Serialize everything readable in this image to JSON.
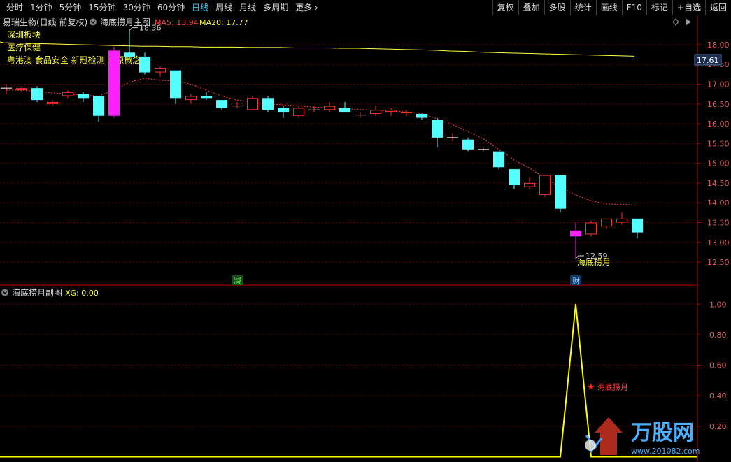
{
  "toolbar": {
    "periods": [
      "分时",
      "1分钟",
      "5分钟",
      "15分钟",
      "30分钟",
      "60分钟",
      "日线",
      "周线",
      "月线",
      "多周期",
      "更多"
    ],
    "active_period": "日线",
    "right_buttons": [
      "复权",
      "叠加",
      "多股",
      "统计",
      "画线",
      "F10",
      "标记",
      "+自选",
      "返回"
    ]
  },
  "main_header": {
    "title": "易瑞生物(日线 前复权)",
    "indicator_name": "海底捞月主图",
    "ma5_label": "MA5: 13.94",
    "ma20_label": "MA20: 17.77",
    "ma5_color": "#ff4040",
    "ma20_color": "#ffff40"
  },
  "info_overlay": {
    "line1": "深圳板块",
    "line2": "医疗保健",
    "line3": "粤港澳 食品安全 新冠检测 抗原概念"
  },
  "sub_header": {
    "name": "海底捞月副图",
    "xg_label": "XG: 0.00"
  },
  "annotations": {
    "high_label": "18.36",
    "low_label": "12.59",
    "signal_label": "海底捞月",
    "sub_signal_label": "海底捞月",
    "marker_jian": "减",
    "marker_cai": "财",
    "current_price": "17.61"
  },
  "watermark": {
    "brand": "万股网",
    "url": "www.201082.com"
  },
  "colors": {
    "up": "#ff3030",
    "down": "#54ffff",
    "signal": "#ff20ff",
    "grid": "#6a0000",
    "axis": "#c00000",
    "xg_line": "#ffff00"
  },
  "chart_data": [
    {
      "type": "candlestick",
      "title": "易瑞生物(日线 前复权)",
      "y_axis_ticks": [
        12.5,
        13.0,
        13.5,
        14.0,
        14.5,
        15.0,
        15.5,
        16.0,
        16.5,
        17.0,
        17.5,
        18.0
      ],
      "ylim": [
        12.2,
        18.6
      ],
      "candles": [
        {
          "o": 16.9,
          "h": 17.0,
          "l": 16.75,
          "c": 16.9
        },
        {
          "o": 16.85,
          "h": 16.95,
          "l": 16.8,
          "c": 16.9
        },
        {
          "o": 16.9,
          "h": 16.95,
          "l": 16.55,
          "c": 16.6
        },
        {
          "o": 16.5,
          "h": 16.6,
          "l": 16.45,
          "c": 16.55
        },
        {
          "o": 16.7,
          "h": 16.85,
          "l": 16.65,
          "c": 16.8
        },
        {
          "o": 16.75,
          "h": 16.8,
          "l": 16.55,
          "c": 16.65
        },
        {
          "o": 16.7,
          "h": 16.7,
          "l": 16.05,
          "c": 16.2
        },
        {
          "o": 16.2,
          "h": 17.95,
          "l": 16.15,
          "c": 17.85,
          "signal": true
        },
        {
          "o": 17.8,
          "h": 18.36,
          "l": 17.7,
          "c": 17.7
        },
        {
          "o": 17.7,
          "h": 17.8,
          "l": 17.25,
          "c": 17.3
        },
        {
          "o": 17.3,
          "h": 17.45,
          "l": 17.2,
          "c": 17.4
        },
        {
          "o": 17.35,
          "h": 17.35,
          "l": 16.5,
          "c": 16.65
        },
        {
          "o": 16.6,
          "h": 16.75,
          "l": 16.5,
          "c": 16.7
        },
        {
          "o": 16.7,
          "h": 16.8,
          "l": 16.6,
          "c": 16.65
        },
        {
          "o": 16.6,
          "h": 16.6,
          "l": 16.35,
          "c": 16.4
        },
        {
          "o": 16.45,
          "h": 16.55,
          "l": 16.4,
          "c": 16.45
        },
        {
          "o": 16.35,
          "h": 16.7,
          "l": 16.35,
          "c": 16.65
        },
        {
          "o": 16.65,
          "h": 16.7,
          "l": 16.3,
          "c": 16.35
        },
        {
          "o": 16.4,
          "h": 16.45,
          "l": 16.15,
          "c": 16.3
        },
        {
          "o": 16.2,
          "h": 16.45,
          "l": 16.15,
          "c": 16.4
        },
        {
          "o": 16.35,
          "h": 16.45,
          "l": 16.3,
          "c": 16.35
        },
        {
          "o": 16.35,
          "h": 16.55,
          "l": 16.3,
          "c": 16.45
        },
        {
          "o": 16.4,
          "h": 16.55,
          "l": 16.3,
          "c": 16.3
        },
        {
          "o": 16.22,
          "h": 16.3,
          "l": 16.15,
          "c": 16.22
        },
        {
          "o": 16.25,
          "h": 16.45,
          "l": 16.2,
          "c": 16.35
        },
        {
          "o": 16.3,
          "h": 16.4,
          "l": 16.2,
          "c": 16.35
        },
        {
          "o": 16.28,
          "h": 16.35,
          "l": 16.2,
          "c": 16.3
        },
        {
          "o": 16.25,
          "h": 16.25,
          "l": 16.1,
          "c": 16.15
        },
        {
          "o": 16.1,
          "h": 16.15,
          "l": 15.4,
          "c": 15.65
        },
        {
          "o": 15.65,
          "h": 15.75,
          "l": 15.55,
          "c": 15.65
        },
        {
          "o": 15.6,
          "h": 15.65,
          "l": 15.3,
          "c": 15.35
        },
        {
          "o": 15.35,
          "h": 15.4,
          "l": 15.3,
          "c": 15.35
        },
        {
          "o": 15.3,
          "h": 15.3,
          "l": 14.85,
          "c": 14.9
        },
        {
          "o": 14.85,
          "h": 14.85,
          "l": 14.35,
          "c": 14.45
        },
        {
          "o": 14.4,
          "h": 14.65,
          "l": 14.35,
          "c": 14.5
        },
        {
          "o": 14.2,
          "h": 14.7,
          "l": 14.15,
          "c": 14.7
        },
        {
          "o": 14.7,
          "h": 14.7,
          "l": 13.75,
          "c": 13.85
        },
        {
          "o": 13.15,
          "h": 13.5,
          "l": 12.59,
          "c": 13.3,
          "signal": true
        },
        {
          "o": 13.2,
          "h": 13.55,
          "l": 13.15,
          "c": 13.5
        },
        {
          "o": 13.4,
          "h": 13.6,
          "l": 13.35,
          "c": 13.6
        },
        {
          "o": 13.5,
          "h": 13.75,
          "l": 13.45,
          "c": 13.6
        },
        {
          "o": 13.6,
          "h": 13.6,
          "l": 13.1,
          "c": 13.25
        }
      ],
      "ma5": [
        16.85,
        16.85,
        16.82,
        16.78,
        16.75,
        16.72,
        16.7,
        16.85,
        17.05,
        17.15,
        17.1,
        17.08,
        17.0,
        16.85,
        16.7,
        16.6,
        16.55,
        16.5,
        16.48,
        16.45,
        16.42,
        16.4,
        16.38,
        16.36,
        16.34,
        16.32,
        16.3,
        16.26,
        16.12,
        15.98,
        15.8,
        15.62,
        15.35,
        15.08,
        14.88,
        14.62,
        14.4,
        14.2,
        14.05,
        13.97,
        13.96,
        13.94
      ],
      "ma20": [
        18.05,
        18.04,
        18.03,
        18.02,
        18.01,
        18.0,
        17.99,
        17.98,
        17.97,
        17.96,
        17.96,
        17.95,
        17.95,
        17.94,
        17.94,
        17.94,
        17.93,
        17.93,
        17.93,
        17.92,
        17.92,
        17.92,
        17.91,
        17.91,
        17.9,
        17.89,
        17.88,
        17.87,
        17.86,
        17.84,
        17.83,
        17.81,
        17.8,
        17.79,
        17.78,
        17.77,
        17.76,
        17.75,
        17.74,
        17.73,
        17.72,
        17.71
      ]
    },
    {
      "type": "line",
      "title": "海底捞月副图",
      "series": [
        {
          "name": "XG",
          "values": [
            0,
            0,
            0,
            0,
            0,
            0,
            0,
            0,
            0,
            0,
            0,
            0,
            0,
            0,
            0,
            0,
            0,
            0,
            0,
            0,
            0,
            0,
            0,
            0,
            0,
            0,
            0,
            0,
            0,
            0,
            0,
            0,
            0,
            0,
            0,
            0,
            0,
            1,
            0,
            0,
            0,
            0
          ]
        }
      ],
      "y_axis_ticks": [
        0.2,
        0.4,
        0.6,
        0.8,
        1.0
      ],
      "ylim": [
        -0.03,
        1.07
      ]
    }
  ]
}
